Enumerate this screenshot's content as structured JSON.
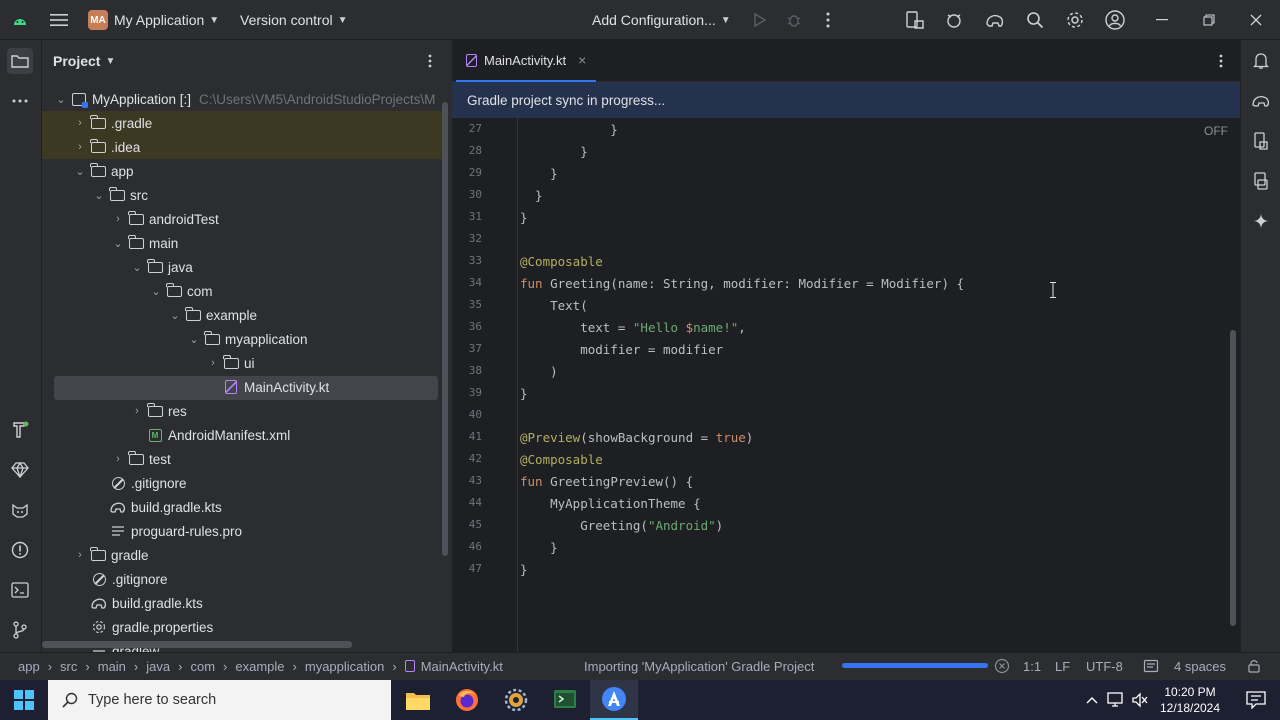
{
  "titlebar": {
    "logo_initials": "MA",
    "project_name": "My Application",
    "vcs_label": "Version control",
    "run_config_label": "Add Configuration..."
  },
  "project_panel": {
    "title": "Project",
    "tree": [
      {
        "label": "MyApplication [:]",
        "extra": "C:\\Users\\VM5\\AndroidStudioProjects\\M",
        "icon": "module-icon"
      },
      {
        "label": ".gradle",
        "icon": "folder-icon"
      },
      {
        "label": ".idea",
        "icon": "folder-icon"
      },
      {
        "label": "app",
        "icon": "folder-icon"
      },
      {
        "label": "src",
        "icon": "folder-icon"
      },
      {
        "label": "androidTest",
        "icon": "folder-icon"
      },
      {
        "label": "main",
        "icon": "folder-icon"
      },
      {
        "label": "java",
        "icon": "folder-icon"
      },
      {
        "label": "com",
        "icon": "folder-icon"
      },
      {
        "label": "example",
        "icon": "folder-icon"
      },
      {
        "label": "myapplication",
        "icon": "folder-icon"
      },
      {
        "label": "ui",
        "icon": "folder-icon"
      },
      {
        "label": "MainActivity.kt",
        "icon": "kotlin-file-icon"
      },
      {
        "label": "res",
        "icon": "folder-icon"
      },
      {
        "label": "AndroidManifest.xml",
        "icon": "manifest-icon"
      },
      {
        "label": "test",
        "icon": "folder-icon"
      },
      {
        "label": ".gitignore",
        "icon": "ignore-icon"
      },
      {
        "label": "build.gradle.kts",
        "icon": "gradle-icon"
      },
      {
        "label": "proguard-rules.pro",
        "icon": "text-file-icon"
      },
      {
        "label": "gradle",
        "icon": "folder-icon"
      },
      {
        "label": ".gitignore",
        "icon": "ignore-icon"
      },
      {
        "label": "build.gradle.kts",
        "icon": "gradle-icon"
      },
      {
        "label": "gradle.properties",
        "icon": "settings-file-icon"
      },
      {
        "label": "gradlew",
        "icon": "text-file-icon"
      }
    ]
  },
  "editor": {
    "tab_label": "MainActivity.kt",
    "tab_close": "×",
    "banner": "Gradle project sync in progress...",
    "inspection_toggle": "OFF",
    "line_numbers": [
      "27",
      "28",
      "29",
      "30",
      "31",
      "32",
      "33",
      "34",
      "35",
      "36",
      "37",
      "38",
      "39",
      "40",
      "41",
      "42",
      "43",
      "44",
      "45",
      "46",
      "47"
    ]
  },
  "statusbar": {
    "breadcrumb": [
      "app",
      "src",
      "main",
      "java",
      "com",
      "example",
      "myapplication",
      "MainActivity.kt"
    ],
    "task": "Importing 'MyApplication' Gradle Project",
    "task_progress": 1.0,
    "position": "1:1",
    "line_sep": "LF",
    "encoding": "UTF-8",
    "indent": "4 spaces"
  },
  "taskbar": {
    "search_placeholder": "Type here to search",
    "time": "10:20 PM",
    "date": "12/18/2024"
  },
  "colors": {
    "accent": "#3574f0",
    "background": "#1e1f22",
    "panel": "#2b2d30",
    "banner": "#25324d",
    "highlight_row": "#3d3822"
  }
}
